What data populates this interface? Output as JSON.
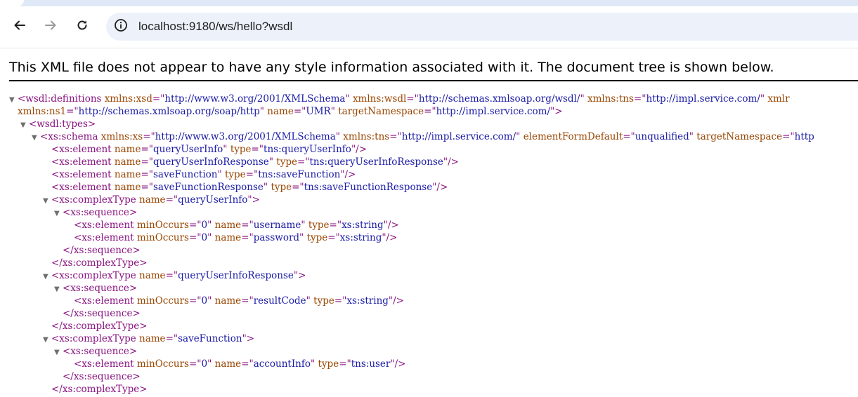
{
  "browser": {
    "url": "localhost:9180/ws/hello?wsdl",
    "back_icon": "arrow-left-icon",
    "forward_icon": "arrow-right-icon",
    "reload_icon": "reload-icon",
    "site_info_icon": "info-circle-icon"
  },
  "banner": {
    "text": "This XML file does not appear to have any style information associated with it. The document tree is shown below."
  },
  "xml": {
    "lines": [
      {
        "arrow": "▼",
        "parts": [
          [
            "t",
            "<wsdl:definitions"
          ],
          [
            "s",
            " "
          ],
          [
            "n",
            "xmlns:xsd"
          ],
          [
            "t",
            "=\""
          ],
          [
            "v",
            "http://www.w3.org/2001/XMLSchema"
          ],
          [
            "t",
            "\""
          ],
          [
            "s",
            " "
          ],
          [
            "n",
            "xmlns:wsdl"
          ],
          [
            "t",
            "=\""
          ],
          [
            "v",
            "http://schemas.xmlsoap.org/wsdl/"
          ],
          [
            "t",
            "\""
          ],
          [
            "s",
            " "
          ],
          [
            "n",
            "xmlns:tns"
          ],
          [
            "t",
            "=\""
          ],
          [
            "v",
            "http://impl.service.com/"
          ],
          [
            "t",
            "\""
          ],
          [
            "s",
            " "
          ],
          [
            "n",
            "xmlr"
          ]
        ]
      },
      {
        "arrow": "",
        "parts": [
          [
            "n",
            "xmlns:ns1"
          ],
          [
            "t",
            "=\""
          ],
          [
            "v",
            "http://schemas.xmlsoap.org/soap/http"
          ],
          [
            "t",
            "\""
          ],
          [
            "s",
            " "
          ],
          [
            "n",
            "name"
          ],
          [
            "t",
            "=\""
          ],
          [
            "v",
            "UMR"
          ],
          [
            "t",
            "\""
          ],
          [
            "s",
            " "
          ],
          [
            "n",
            "targetNamespace"
          ],
          [
            "t",
            "=\""
          ],
          [
            "v",
            "http://impl.service.com/"
          ],
          [
            "t",
            "\">"
          ]
        ]
      },
      {
        "arrow": "▼",
        "parts": [
          [
            "t",
            "<wsdl:types>"
          ]
        ]
      },
      {
        "arrow": "▼",
        "parts": [
          [
            "t",
            "<xs:schema"
          ],
          [
            "s",
            " "
          ],
          [
            "n",
            "xmlns:xs"
          ],
          [
            "t",
            "=\""
          ],
          [
            "v",
            "http://www.w3.org/2001/XMLSchema"
          ],
          [
            "t",
            "\""
          ],
          [
            "s",
            " "
          ],
          [
            "n",
            "xmlns:tns"
          ],
          [
            "t",
            "=\""
          ],
          [
            "v",
            "http://impl.service.com/"
          ],
          [
            "t",
            "\""
          ],
          [
            "s",
            " "
          ],
          [
            "n",
            "elementFormDefault"
          ],
          [
            "t",
            "=\""
          ],
          [
            "v",
            "unqualified"
          ],
          [
            "t",
            "\""
          ],
          [
            "s",
            " "
          ],
          [
            "n",
            "targetNamespace"
          ],
          [
            "t",
            "=\""
          ],
          [
            "v",
            "http"
          ]
        ]
      },
      {
        "arrow": "",
        "parts": [
          [
            "t",
            "<xs:element"
          ],
          [
            "s",
            " "
          ],
          [
            "n",
            "name"
          ],
          [
            "t",
            "=\""
          ],
          [
            "v",
            "queryUserInfo"
          ],
          [
            "t",
            "\""
          ],
          [
            "s",
            " "
          ],
          [
            "n",
            "type"
          ],
          [
            "t",
            "=\""
          ],
          [
            "v",
            "tns:queryUserInfo"
          ],
          [
            "t",
            "\"/>"
          ]
        ]
      },
      {
        "arrow": "",
        "parts": [
          [
            "t",
            "<xs:element"
          ],
          [
            "s",
            " "
          ],
          [
            "n",
            "name"
          ],
          [
            "t",
            "=\""
          ],
          [
            "v",
            "queryUserInfoResponse"
          ],
          [
            "t",
            "\""
          ],
          [
            "s",
            " "
          ],
          [
            "n",
            "type"
          ],
          [
            "t",
            "=\""
          ],
          [
            "v",
            "tns:queryUserInfoResponse"
          ],
          [
            "t",
            "\"/>"
          ]
        ]
      },
      {
        "arrow": "",
        "parts": [
          [
            "t",
            "<xs:element"
          ],
          [
            "s",
            " "
          ],
          [
            "n",
            "name"
          ],
          [
            "t",
            "=\""
          ],
          [
            "v",
            "saveFunction"
          ],
          [
            "t",
            "\""
          ],
          [
            "s",
            " "
          ],
          [
            "n",
            "type"
          ],
          [
            "t",
            "=\""
          ],
          [
            "v",
            "tns:saveFunction"
          ],
          [
            "t",
            "\"/>"
          ]
        ]
      },
      {
        "arrow": "",
        "parts": [
          [
            "t",
            "<xs:element"
          ],
          [
            "s",
            " "
          ],
          [
            "n",
            "name"
          ],
          [
            "t",
            "=\""
          ],
          [
            "v",
            "saveFunctionResponse"
          ],
          [
            "t",
            "\""
          ],
          [
            "s",
            " "
          ],
          [
            "n",
            "type"
          ],
          [
            "t",
            "=\""
          ],
          [
            "v",
            "tns:saveFunctionResponse"
          ],
          [
            "t",
            "\"/>"
          ]
        ]
      },
      {
        "arrow": "▼",
        "parts": [
          [
            "t",
            "<xs:complexType"
          ],
          [
            "s",
            " "
          ],
          [
            "n",
            "name"
          ],
          [
            "t",
            "=\""
          ],
          [
            "v",
            "queryUserInfo"
          ],
          [
            "t",
            "\">"
          ]
        ]
      },
      {
        "arrow": "▼",
        "parts": [
          [
            "t",
            "<xs:sequence>"
          ]
        ]
      },
      {
        "arrow": "",
        "parts": [
          [
            "t",
            "<xs:element"
          ],
          [
            "s",
            " "
          ],
          [
            "n",
            "minOccurs"
          ],
          [
            "t",
            "=\""
          ],
          [
            "v",
            "0"
          ],
          [
            "t",
            "\""
          ],
          [
            "s",
            " "
          ],
          [
            "n",
            "name"
          ],
          [
            "t",
            "=\""
          ],
          [
            "v",
            "username"
          ],
          [
            "t",
            "\""
          ],
          [
            "s",
            " "
          ],
          [
            "n",
            "type"
          ],
          [
            "t",
            "=\""
          ],
          [
            "v",
            "xs:string"
          ],
          [
            "t",
            "\"/>"
          ]
        ]
      },
      {
        "arrow": "",
        "parts": [
          [
            "t",
            "<xs:element"
          ],
          [
            "s",
            " "
          ],
          [
            "n",
            "minOccurs"
          ],
          [
            "t",
            "=\""
          ],
          [
            "v",
            "0"
          ],
          [
            "t",
            "\""
          ],
          [
            "s",
            " "
          ],
          [
            "n",
            "name"
          ],
          [
            "t",
            "=\""
          ],
          [
            "v",
            "password"
          ],
          [
            "t",
            "\""
          ],
          [
            "s",
            " "
          ],
          [
            "n",
            "type"
          ],
          [
            "t",
            "=\""
          ],
          [
            "v",
            "xs:string"
          ],
          [
            "t",
            "\"/>"
          ]
        ]
      },
      {
        "arrow": "",
        "parts": [
          [
            "t",
            "</xs:sequence>"
          ]
        ]
      },
      {
        "arrow": "",
        "parts": [
          [
            "t",
            "</xs:complexType>"
          ]
        ]
      },
      {
        "arrow": "▼",
        "parts": [
          [
            "t",
            "<xs:complexType"
          ],
          [
            "s",
            " "
          ],
          [
            "n",
            "name"
          ],
          [
            "t",
            "=\""
          ],
          [
            "v",
            "queryUserInfoResponse"
          ],
          [
            "t",
            "\">"
          ]
        ]
      },
      {
        "arrow": "▼",
        "parts": [
          [
            "t",
            "<xs:sequence>"
          ]
        ]
      },
      {
        "arrow": "",
        "parts": [
          [
            "t",
            "<xs:element"
          ],
          [
            "s",
            " "
          ],
          [
            "n",
            "minOccurs"
          ],
          [
            "t",
            "=\""
          ],
          [
            "v",
            "0"
          ],
          [
            "t",
            "\""
          ],
          [
            "s",
            " "
          ],
          [
            "n",
            "name"
          ],
          [
            "t",
            "=\""
          ],
          [
            "v",
            "resultCode"
          ],
          [
            "t",
            "\""
          ],
          [
            "s",
            " "
          ],
          [
            "n",
            "type"
          ],
          [
            "t",
            "=\""
          ],
          [
            "v",
            "xs:string"
          ],
          [
            "t",
            "\"/>"
          ]
        ]
      },
      {
        "arrow": "",
        "parts": [
          [
            "t",
            "</xs:sequence>"
          ]
        ]
      },
      {
        "arrow": "",
        "parts": [
          [
            "t",
            "</xs:complexType>"
          ]
        ]
      },
      {
        "arrow": "▼",
        "parts": [
          [
            "t",
            "<xs:complexType"
          ],
          [
            "s",
            " "
          ],
          [
            "n",
            "name"
          ],
          [
            "t",
            "=\""
          ],
          [
            "v",
            "saveFunction"
          ],
          [
            "t",
            "\">"
          ]
        ]
      },
      {
        "arrow": "▼",
        "parts": [
          [
            "t",
            "<xs:sequence>"
          ]
        ]
      },
      {
        "arrow": "",
        "parts": [
          [
            "t",
            "<xs:element"
          ],
          [
            "s",
            " "
          ],
          [
            "n",
            "minOccurs"
          ],
          [
            "t",
            "=\""
          ],
          [
            "v",
            "0"
          ],
          [
            "t",
            "\""
          ],
          [
            "s",
            " "
          ],
          [
            "n",
            "name"
          ],
          [
            "t",
            "=\""
          ],
          [
            "v",
            "accountInfo"
          ],
          [
            "t",
            "\""
          ],
          [
            "s",
            " "
          ],
          [
            "n",
            "type"
          ],
          [
            "t",
            "=\""
          ],
          [
            "v",
            "tns:user"
          ],
          [
            "t",
            "\"/>"
          ]
        ]
      },
      {
        "arrow": "",
        "parts": [
          [
            "t",
            "</xs:sequence>"
          ]
        ]
      },
      {
        "arrow": "",
        "parts": [
          [
            "t",
            "</xs:complexType>"
          ]
        ]
      }
    ]
  }
}
